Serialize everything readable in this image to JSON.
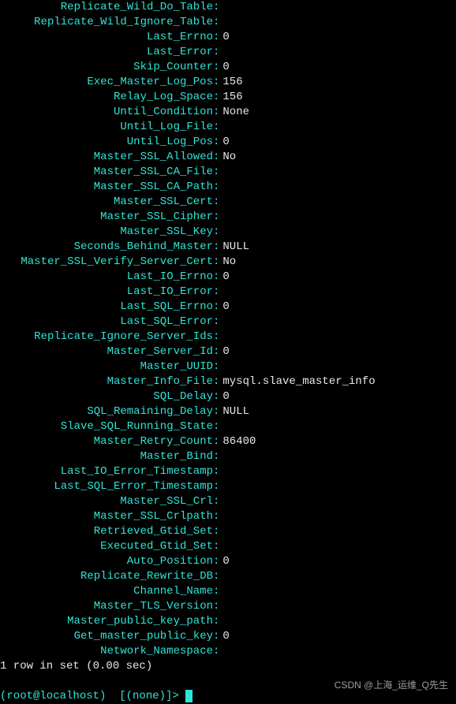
{
  "rows": [
    {
      "key": "Replicate_Wild_Do_Table",
      "value": ""
    },
    {
      "key": "Replicate_Wild_Ignore_Table",
      "value": ""
    },
    {
      "key": "Last_Errno",
      "value": "0"
    },
    {
      "key": "Last_Error",
      "value": ""
    },
    {
      "key": "Skip_Counter",
      "value": "0"
    },
    {
      "key": "Exec_Master_Log_Pos",
      "value": "156"
    },
    {
      "key": "Relay_Log_Space",
      "value": "156"
    },
    {
      "key": "Until_Condition",
      "value": "None"
    },
    {
      "key": "Until_Log_File",
      "value": ""
    },
    {
      "key": "Until_Log_Pos",
      "value": "0"
    },
    {
      "key": "Master_SSL_Allowed",
      "value": "No"
    },
    {
      "key": "Master_SSL_CA_File",
      "value": ""
    },
    {
      "key": "Master_SSL_CA_Path",
      "value": ""
    },
    {
      "key": "Master_SSL_Cert",
      "value": ""
    },
    {
      "key": "Master_SSL_Cipher",
      "value": ""
    },
    {
      "key": "Master_SSL_Key",
      "value": ""
    },
    {
      "key": "Seconds_Behind_Master",
      "value": "NULL"
    },
    {
      "key": "Master_SSL_Verify_Server_Cert",
      "value": "No"
    },
    {
      "key": "Last_IO_Errno",
      "value": "0"
    },
    {
      "key": "Last_IO_Error",
      "value": ""
    },
    {
      "key": "Last_SQL_Errno",
      "value": "0"
    },
    {
      "key": "Last_SQL_Error",
      "value": ""
    },
    {
      "key": "Replicate_Ignore_Server_Ids",
      "value": ""
    },
    {
      "key": "Master_Server_Id",
      "value": "0"
    },
    {
      "key": "Master_UUID",
      "value": ""
    },
    {
      "key": "Master_Info_File",
      "value": "mysql.slave_master_info"
    },
    {
      "key": "SQL_Delay",
      "value": "0"
    },
    {
      "key": "SQL_Remaining_Delay",
      "value": "NULL"
    },
    {
      "key": "Slave_SQL_Running_State",
      "value": ""
    },
    {
      "key": "Master_Retry_Count",
      "value": "86400"
    },
    {
      "key": "Master_Bind",
      "value": ""
    },
    {
      "key": "Last_IO_Error_Timestamp",
      "value": ""
    },
    {
      "key": "Last_SQL_Error_Timestamp",
      "value": ""
    },
    {
      "key": "Master_SSL_Crl",
      "value": ""
    },
    {
      "key": "Master_SSL_Crlpath",
      "value": ""
    },
    {
      "key": "Retrieved_Gtid_Set",
      "value": ""
    },
    {
      "key": "Executed_Gtid_Set",
      "value": ""
    },
    {
      "key": "Auto_Position",
      "value": "0"
    },
    {
      "key": "Replicate_Rewrite_DB",
      "value": ""
    },
    {
      "key": "Channel_Name",
      "value": ""
    },
    {
      "key": "Master_TLS_Version",
      "value": ""
    },
    {
      "key": "Master_public_key_path",
      "value": ""
    },
    {
      "key": "Get_master_public_key",
      "value": "0"
    },
    {
      "key": "Network_Namespace",
      "value": ""
    }
  ],
  "footer": "1 row in set (0.00 sec)",
  "prompt": {
    "user": "(root@localhost)  [(none)]> "
  },
  "watermark": "CSDN @上海_运维_Q先生"
}
